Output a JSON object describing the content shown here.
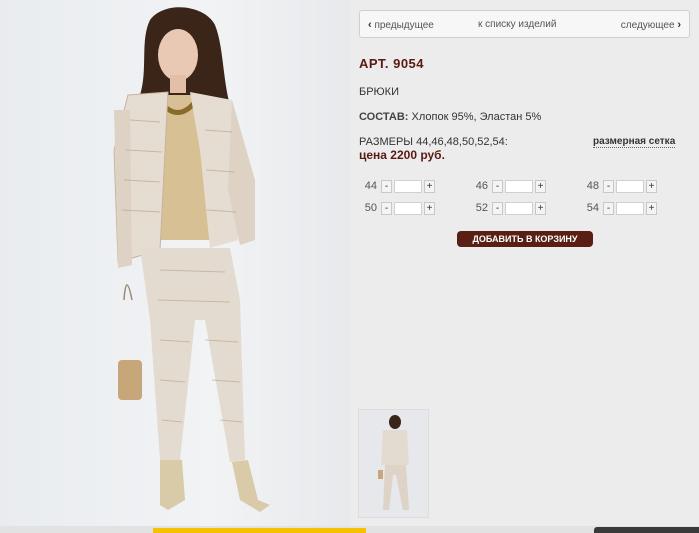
{
  "nav": {
    "prev": "предыдущее",
    "list": "к списку изделий",
    "next": "следующее"
  },
  "product": {
    "article": "АРТ. 9054",
    "type": "БРЮКИ",
    "composition_label": "СОСТАВ:",
    "composition": "Хлопок 95%, Эластан 5%",
    "sizes": "РАЗМЕРЫ 44,46,48,50,52,54:",
    "size_chart": "размерная сетка",
    "price": "цена 2200 руб."
  },
  "quantities": [
    {
      "size": "44",
      "value": ""
    },
    {
      "size": "46",
      "value": ""
    },
    {
      "size": "48",
      "value": ""
    },
    {
      "size": "50",
      "value": ""
    },
    {
      "size": "52",
      "value": ""
    },
    {
      "size": "54",
      "value": ""
    }
  ],
  "controls": {
    "minus": "-",
    "plus": "+",
    "add_to_cart": "ДОБАВИТЬ В КОРЗИНУ"
  },
  "colors": {
    "accent": "#5a1a12",
    "button": "#5a1f14"
  }
}
